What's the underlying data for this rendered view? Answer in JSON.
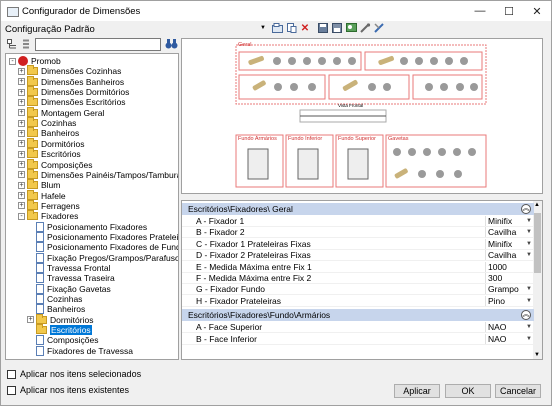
{
  "window": {
    "title": "Configurador de Dimensões",
    "minimize": "—",
    "maximize": "☐",
    "close": "✕"
  },
  "config_label": "Configuração Padrão",
  "search": {
    "value": ""
  },
  "toolbar_icons": [
    "dropdown-icon",
    "open-icon",
    "new-icon",
    "delete-icon",
    "save-icon",
    "save-as-icon",
    "gallery-icon",
    "wrench-icon",
    "tools-icon"
  ],
  "tree": [
    {
      "label": "Promob",
      "level": 0,
      "type": "root",
      "exp": "-"
    },
    {
      "label": "Dimensões Cozinhas",
      "level": 1,
      "type": "folder",
      "exp": "+"
    },
    {
      "label": "Dimensões Banheiros",
      "level": 1,
      "type": "folder",
      "exp": "+"
    },
    {
      "label": "Dimensões Dormitórios",
      "level": 1,
      "type": "folder",
      "exp": "+"
    },
    {
      "label": "Dimensões Escritórios",
      "level": 1,
      "type": "folder",
      "exp": "+"
    },
    {
      "label": "Montagem Geral",
      "level": 1,
      "type": "folder",
      "exp": "+"
    },
    {
      "label": "Cozinhas",
      "level": 1,
      "type": "folder",
      "exp": "+"
    },
    {
      "label": "Banheiros",
      "level": 1,
      "type": "folder",
      "exp": "+"
    },
    {
      "label": "Dormitórios",
      "level": 1,
      "type": "folder",
      "exp": "+"
    },
    {
      "label": "Escritórios",
      "level": 1,
      "type": "folder",
      "exp": "+"
    },
    {
      "label": "Composições",
      "level": 1,
      "type": "folder",
      "exp": "+"
    },
    {
      "label": "Dimensões Painéis/Tampos/Tamburatos",
      "level": 1,
      "type": "folder",
      "exp": "+"
    },
    {
      "label": "Blum",
      "level": 1,
      "type": "folder",
      "exp": "+"
    },
    {
      "label": "Hafele",
      "level": 1,
      "type": "folder",
      "exp": "+"
    },
    {
      "label": "Ferragens",
      "level": 1,
      "type": "folder",
      "exp": "+"
    },
    {
      "label": "Fixadores",
      "level": 1,
      "type": "folder",
      "exp": "-"
    },
    {
      "label": "Posicionamento Fixadores",
      "level": 2,
      "type": "doc",
      "exp": ""
    },
    {
      "label": "Posicionamento Fixadores Prateleiras",
      "level": 2,
      "type": "doc",
      "exp": ""
    },
    {
      "label": "Posicionamento Fixadores de Fundo",
      "level": 2,
      "type": "doc",
      "exp": ""
    },
    {
      "label": "Fixação Pregos/Grampos/Parafusos",
      "level": 2,
      "type": "doc",
      "exp": ""
    },
    {
      "label": "Travessa Frontal",
      "level": 2,
      "type": "doc",
      "exp": ""
    },
    {
      "label": "Travessa Traseira",
      "level": 2,
      "type": "doc",
      "exp": ""
    },
    {
      "label": "Fixação Gavetas",
      "level": 2,
      "type": "doc",
      "exp": ""
    },
    {
      "label": "Cozinhas",
      "level": 2,
      "type": "doc",
      "exp": ""
    },
    {
      "label": "Banheiros",
      "level": 2,
      "type": "doc",
      "exp": ""
    },
    {
      "label": "Dormitórios",
      "level": 2,
      "type": "folder",
      "exp": "+"
    },
    {
      "label": "Escritórios",
      "level": 2,
      "type": "folder",
      "exp": "",
      "selected": true
    },
    {
      "label": "Composições",
      "level": 2,
      "type": "doc",
      "exp": ""
    },
    {
      "label": "Fixadores de Travessa",
      "level": 2,
      "type": "doc",
      "exp": ""
    }
  ],
  "preview": {
    "geral": "Geral",
    "vista_frontal": "Vista Frontal",
    "fundo_armarios": "Fundo Armários",
    "fundo_inferior": "Fundo Inferior",
    "fundo_superior": "Fundo Superior",
    "gavetas": "Gavetas"
  },
  "groups": [
    {
      "title": "Escritórios\\Fixadores\\ Geral",
      "rows": [
        {
          "name": "A - Fixador 1",
          "value": "Minifix",
          "dd": true
        },
        {
          "name": "B - Fixador 2",
          "value": "Cavilha",
          "dd": true
        },
        {
          "name": "C - Fixador 1 Prateleiras Fixas",
          "value": "Minifix",
          "dd": true
        },
        {
          "name": "D - Fixador 2 Prateleiras Fixas",
          "value": "Cavilha",
          "dd": true
        },
        {
          "name": "E - Medida Máxima entre Fix 1",
          "value": "1000",
          "dd": false
        },
        {
          "name": "F - Medida Máxima entre Fix 2",
          "value": "300",
          "dd": false
        },
        {
          "name": "G - Fixador Fundo",
          "value": "Grampo",
          "dd": true
        },
        {
          "name": "H - Fixador Prateleiras",
          "value": "Pino",
          "dd": true
        }
      ]
    },
    {
      "title": "Escritórios\\Fixadores\\Fundo\\Armários",
      "rows": [
        {
          "name": "A - Face Superior",
          "value": "NAO",
          "dd": true
        },
        {
          "name": "B - Face Inferior",
          "value": "NAO",
          "dd": true
        }
      ]
    }
  ],
  "checks": {
    "selected_items": "Aplicar nos itens selecionados",
    "existing_items": "Aplicar nos itens existentes"
  },
  "buttons": {
    "apply": "Aplicar",
    "ok": "OK",
    "cancel": "Cancelar"
  },
  "colors": {
    "accent": "#0078d7",
    "group_header": "#c7d5ec",
    "preview_border": "#e87a7a"
  }
}
